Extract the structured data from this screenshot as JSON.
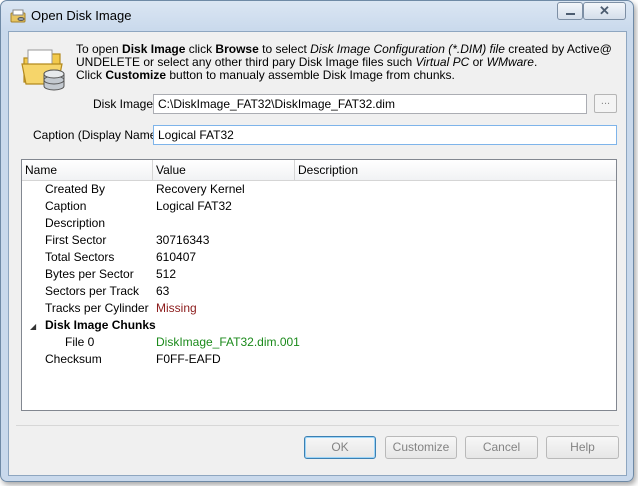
{
  "window": {
    "title": "Open Disk Image",
    "minimize_glyph": "",
    "close_glyph": "✕"
  },
  "info": {
    "line1_pre": "To open ",
    "line1_bold1": "Disk Image",
    "line1_mid": " click ",
    "line1_bold2": "Browse",
    "line1_post": " to select ",
    "line1_italic": "Disk Image Configuration (*.DIM) file",
    "line1_end": " created by Active@",
    "line2_pre": "UNDELETE or select any other third pary Disk Image files such ",
    "line2_italic1": "Virtual PC",
    "line2_mid": " or ",
    "line2_italic2": "WMware",
    "line2_end": ".",
    "line3_pre": "Click ",
    "line3_bold": "Customize",
    "line3_post": " button to manualy assemble Disk Image from chunks."
  },
  "form": {
    "disk_image_label": "Disk Image:",
    "disk_image_value": "C:\\DiskImage_FAT32\\DiskImage_FAT32.dim",
    "browse_label": "...",
    "caption_label": "Caption (Display Name):",
    "caption_value": "Logical FAT32"
  },
  "grid": {
    "columns": [
      "Name",
      "Value",
      "Description"
    ],
    "rows": [
      {
        "name": "Created By",
        "value": "Recovery Kernel"
      },
      {
        "name": "Caption",
        "value": "Logical FAT32"
      },
      {
        "name": "Description",
        "value": ""
      },
      {
        "name": "First Sector",
        "value": "30716343"
      },
      {
        "name": "Total Sectors",
        "value": "610407"
      },
      {
        "name": "Bytes per Sector",
        "value": "512"
      },
      {
        "name": "Sectors per Track",
        "value": "63"
      },
      {
        "name": "Tracks per Cylinder",
        "value": "Missing"
      }
    ],
    "group": {
      "name": "Disk Image Chunks",
      "expander": "◢"
    },
    "chunk": {
      "name": "File 0",
      "value": "DiskImage_FAT32.dim.001"
    },
    "checksum": {
      "name": "Checksum",
      "value": "F0FF-EAFD"
    }
  },
  "colors": {
    "missing": "#8b1a1a",
    "chunk_value": "#1b8a1b"
  },
  "buttons": {
    "ok": "OK",
    "customize": "Customize",
    "cancel": "Cancel",
    "help": "Help"
  }
}
